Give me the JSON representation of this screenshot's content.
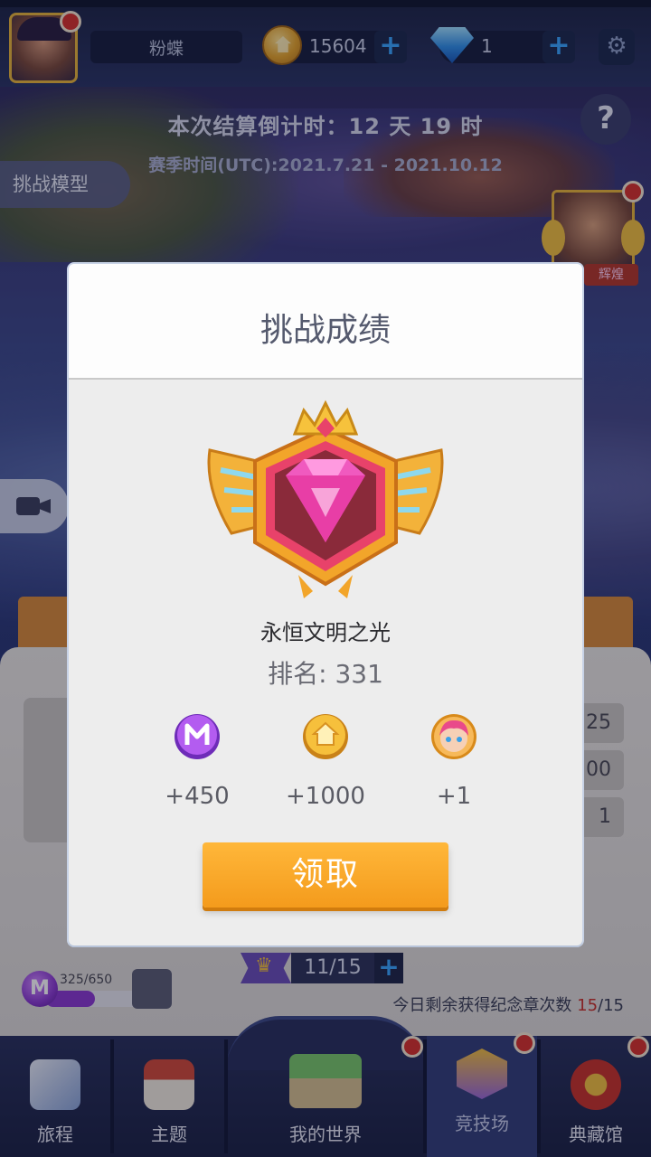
{
  "header": {
    "player_name": "粉蝶",
    "coins": "15604",
    "gems": "1"
  },
  "season": {
    "countdown": "本次结算倒计时：12 天 19 时",
    "period": "赛季时间(UTC):2021.7.21 - 2021.10.12"
  },
  "side": {
    "challenge_model_label": "挑战模型",
    "rank_tag": "辉煌"
  },
  "background_panel": {
    "rows": [
      "25",
      "00",
      "1"
    ],
    "medal_count": "11/15",
    "exp_text": "325/650",
    "exp_progress": 0.5,
    "remaining_label": "今日剩余获得纪念章次数",
    "remaining_used": "15",
    "remaining_total": "/15"
  },
  "modal": {
    "title": "挑战成绩",
    "rank_name": "永恒文明之光",
    "rank_position": "排名: 331",
    "rewards": [
      {
        "icon": "m-token-icon",
        "amount": "+450"
      },
      {
        "icon": "house-coin-icon",
        "amount": "+1000"
      },
      {
        "icon": "character-avatar-icon",
        "amount": "+1"
      }
    ],
    "claim_label": "领取"
  },
  "bottom_nav": {
    "items": [
      {
        "label": "旅程",
        "icon": "journey-icon"
      },
      {
        "label": "主题",
        "icon": "theme-house-icon"
      },
      {
        "label": "我的世界",
        "icon": "my-world-icon"
      },
      {
        "label": "竞技场",
        "icon": "arena-crown-icon"
      },
      {
        "label": "典藏馆",
        "icon": "collection-star-icon"
      }
    ]
  },
  "colors": {
    "claim_button": "#f49b1c",
    "accent_blue": "#39a6ff",
    "badge_pink": "#e83ea6",
    "notification_red": "#d8322c"
  }
}
